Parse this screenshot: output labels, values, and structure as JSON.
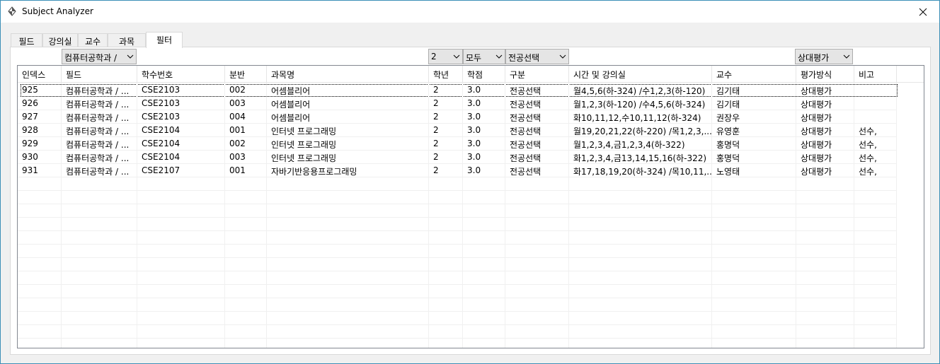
{
  "window": {
    "title": "Subject Analyzer"
  },
  "tabs": [
    {
      "label": "필드",
      "active": false
    },
    {
      "label": "강의실",
      "active": false
    },
    {
      "label": "교수",
      "active": false
    },
    {
      "label": "과목",
      "active": false
    },
    {
      "label": "필터",
      "active": true
    }
  ],
  "filters": {
    "field": "컴퓨터공학과 /",
    "grade": "2",
    "credit": "모두",
    "category": "전공선택",
    "evaluation": "상대평가"
  },
  "columns": [
    "인덱스",
    "필드",
    "학수번호",
    "분반",
    "과목명",
    "학년",
    "학점",
    "구분",
    "시간 및 강의실",
    "교수",
    "평가방식",
    "비고"
  ],
  "rows": [
    [
      "925",
      "컴퓨터공학과 / ...",
      "CSE2103",
      "002",
      "어셈블리어",
      "2",
      "3.0",
      "전공선택",
      "월4,5,6(하-324) /수1,2,3(하-120)",
      "김기태",
      "상대평가",
      ""
    ],
    [
      "926",
      "컴퓨터공학과 / ...",
      "CSE2103",
      "003",
      "어셈블리어",
      "2",
      "3.0",
      "전공선택",
      "월1,2,3(하-120) /수4,5,6(하-324)",
      "김기태",
      "상대평가",
      ""
    ],
    [
      "927",
      "컴퓨터공학과 / ...",
      "CSE2103",
      "004",
      "어셈블리어",
      "2",
      "3.0",
      "전공선택",
      "화10,11,12,수10,11,12(하-324)",
      "권장우",
      "상대평가",
      ""
    ],
    [
      "928",
      "컴퓨터공학과 / ...",
      "CSE2104",
      "001",
      "인터넷 프로그래밍",
      "2",
      "3.0",
      "전공선택",
      "월19,20,21,22(하-220) /목1,2,3,...",
      "유영훈",
      "상대평가",
      "선수,"
    ],
    [
      "929",
      "컴퓨터공학과 / ...",
      "CSE2104",
      "002",
      "인터넷 프로그래밍",
      "2",
      "3.0",
      "전공선택",
      "월1,2,3,4,금1,2,3,4(하-322)",
      "홍명덕",
      "상대평가",
      "선수,"
    ],
    [
      "930",
      "컴퓨터공학과 / ...",
      "CSE2104",
      "003",
      "인터넷 프로그래밍",
      "2",
      "3.0",
      "전공선택",
      "화1,2,3,4,금13,14,15,16(하-322)",
      "홍명덕",
      "상대평가",
      "선수,"
    ],
    [
      "931",
      "컴퓨터공학과 / ...",
      "CSE2107",
      "001",
      "자바기반응용프로그래밍",
      "2",
      "3.0",
      "전공선택",
      "화17,18,19,20(하-324) /목10,11,...",
      "노영태",
      "상대평가",
      "선수,"
    ]
  ]
}
